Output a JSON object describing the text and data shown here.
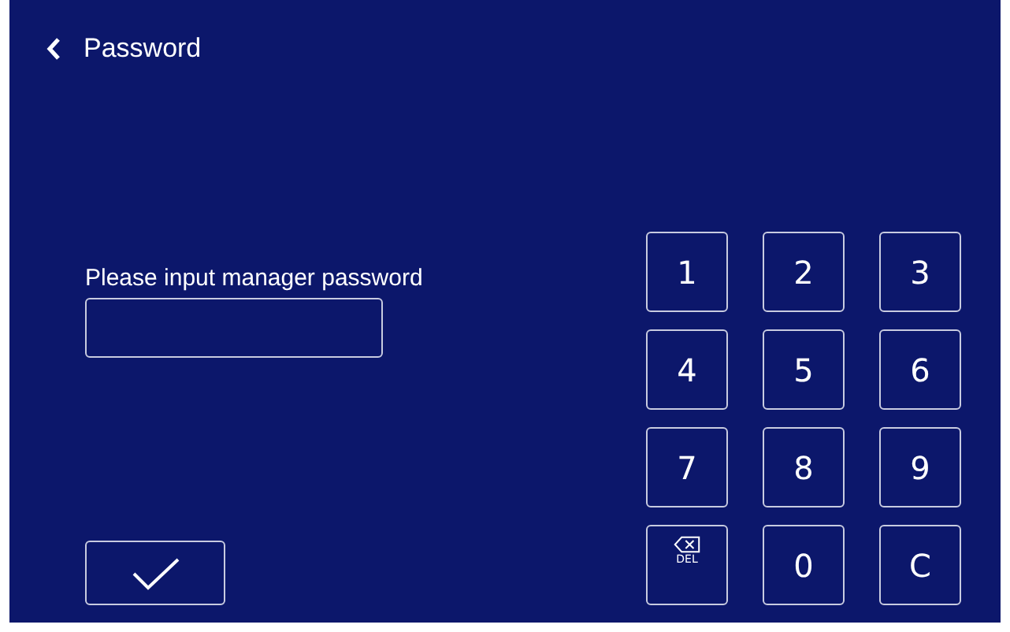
{
  "header": {
    "title": "Password"
  },
  "prompt": "Please input manager password",
  "keypad": [
    {
      "kind": "digit",
      "label": "1"
    },
    {
      "kind": "digit",
      "label": "2"
    },
    {
      "kind": "digit",
      "label": "3"
    },
    {
      "kind": "digit",
      "label": "4"
    },
    {
      "kind": "digit",
      "label": "5"
    },
    {
      "kind": "digit",
      "label": "6"
    },
    {
      "kind": "digit",
      "label": "7"
    },
    {
      "kind": "digit",
      "label": "8"
    },
    {
      "kind": "digit",
      "label": "9"
    },
    {
      "kind": "delete",
      "label": "DEL"
    },
    {
      "kind": "digit",
      "label": "0"
    },
    {
      "kind": "digit",
      "label": "C"
    }
  ]
}
